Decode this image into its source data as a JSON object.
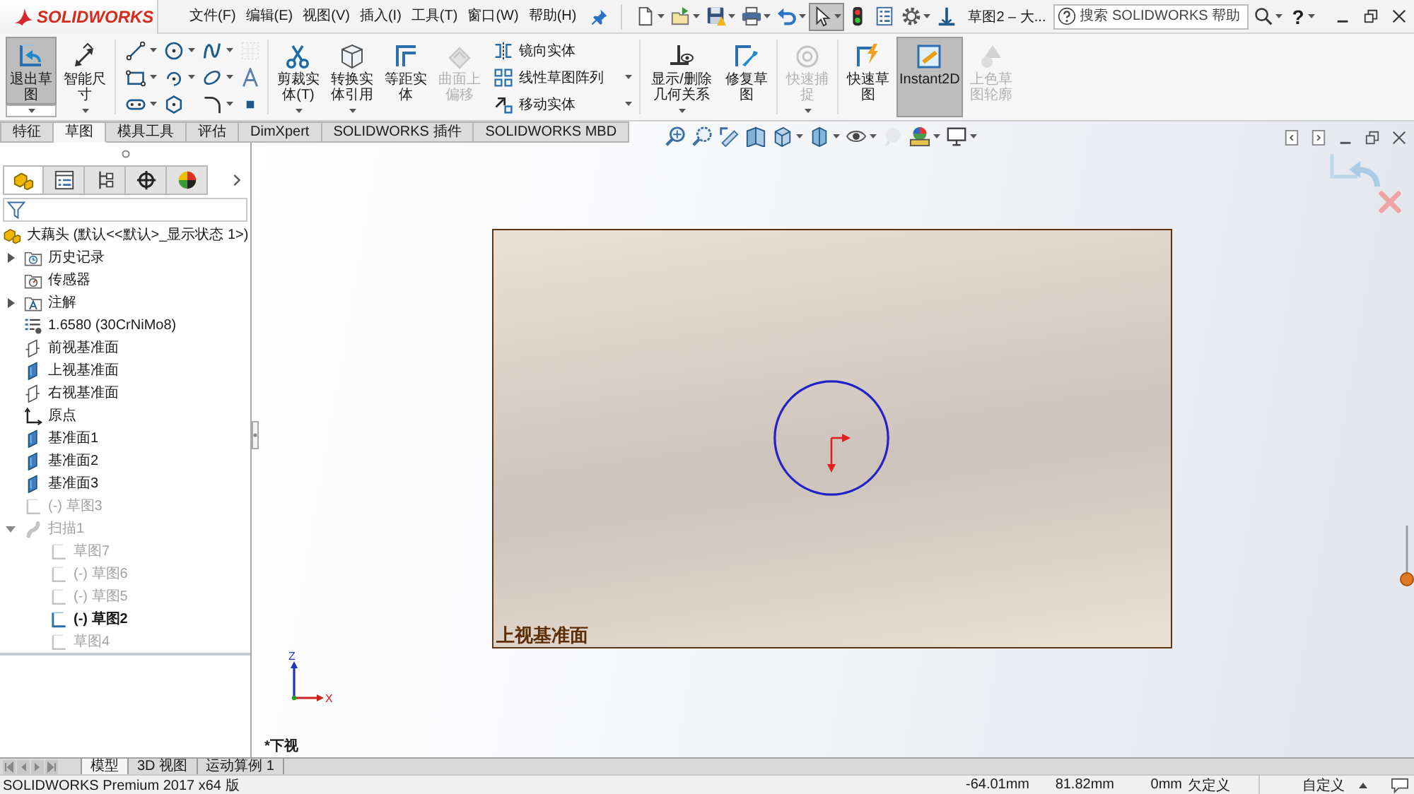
{
  "title_bar": {
    "logo": "SOLIDWORKS",
    "menu": [
      "文件(F)",
      "编辑(E)",
      "视图(V)",
      "插入(I)",
      "工具(T)",
      "窗口(W)",
      "帮助(H)"
    ],
    "quick_tools": [
      {
        "kind": "new",
        "dropdown": true,
        "selected": false
      },
      {
        "kind": "open",
        "dropdown": true,
        "selected": false
      },
      {
        "kind": "save",
        "dropdown": true,
        "selected": false
      },
      {
        "kind": "print",
        "dropdown": true,
        "selected": false
      },
      {
        "kind": "undo",
        "dropdown": true,
        "selected": false
      },
      {
        "kind": "select",
        "dropdown": true,
        "selected": true
      },
      {
        "kind": "rebuild",
        "dropdown": false,
        "selected": false
      },
      {
        "kind": "properties",
        "dropdown": false,
        "selected": false
      },
      {
        "kind": "options",
        "dropdown": true,
        "selected": false
      },
      {
        "kind": "perpendicular",
        "dropdown": false,
        "selected": false
      }
    ],
    "document_title": "草图2 – 大...",
    "search": {
      "placeholder": "搜索 SOLIDWORKS 帮助"
    },
    "help": "?"
  },
  "ribbon": {
    "groups": [
      {
        "buttons": [
          {
            "kind": "exit",
            "label": "退出草图",
            "selected": true,
            "disabled": false,
            "dropdown": true
          },
          {
            "kind": "dimension",
            "label": "智能尺寸",
            "selected": false,
            "disabled": false,
            "dropdown": true
          }
        ]
      },
      {
        "tools": [
          {
            "kind": "line",
            "dropdown": true,
            "disabled": false
          },
          {
            "kind": "circle",
            "dropdown": true,
            "disabled": false
          },
          {
            "kind": "spline",
            "dropdown": true,
            "disabled": false
          },
          {
            "kind": "grid",
            "dropdown": false,
            "disabled": true
          },
          {
            "kind": "rectangle",
            "dropdown": true,
            "disabled": false
          },
          {
            "kind": "arc",
            "dropdown": true,
            "disabled": false
          },
          {
            "kind": "ellipse",
            "dropdown": true,
            "disabled": false
          },
          {
            "kind": "text",
            "dropdown": false,
            "disabled": false
          },
          {
            "kind": "slot",
            "dropdown": true,
            "disabled": false
          },
          {
            "kind": "polygon",
            "dropdown": false,
            "disabled": false
          },
          {
            "kind": "fillet",
            "dropdown": true,
            "disabled": false
          },
          {
            "kind": "point",
            "dropdown": false,
            "disabled": false
          }
        ]
      },
      {
        "buttons": [
          {
            "kind": "trim",
            "label": "剪裁实体(T)",
            "selected": false,
            "disabled": false,
            "dropdown": true
          },
          {
            "kind": "convert",
            "label": "转换实体引用",
            "selected": false,
            "disabled": false,
            "dropdown": true
          },
          {
            "kind": "offset",
            "label": "等距实体",
            "selected": false,
            "disabled": false,
            "dropdown": false
          },
          {
            "kind": "surfaceoffset",
            "label": "曲面上偏移",
            "selected": false,
            "disabled": true,
            "dropdown": false
          }
        ],
        "rows": [
          {
            "kind": "mirror",
            "label": "镜向实体",
            "dropdown": false
          },
          {
            "kind": "pattern",
            "label": "线性草图阵列",
            "dropdown": true
          },
          {
            "kind": "move",
            "label": "移动实体",
            "dropdown": true
          }
        ]
      },
      {
        "buttons": [
          {
            "kind": "relations",
            "label": "显示/删除几何关系",
            "selected": false,
            "disabled": false,
            "dropdown": true
          },
          {
            "kind": "repair",
            "label": "修复草图",
            "selected": false,
            "disabled": false,
            "dropdown": false
          }
        ]
      },
      {
        "buttons": [
          {
            "kind": "snap",
            "label": "快速捕捉",
            "selected": false,
            "disabled": true,
            "dropdown": true
          }
        ]
      },
      {
        "buttons": [
          {
            "kind": "rapid",
            "label": "快速草图",
            "selected": false,
            "disabled": false,
            "dropdown": false
          },
          {
            "kind": "instant2d",
            "label": "Instant2D",
            "selected": true,
            "disabled": false,
            "dropdown": false
          },
          {
            "kind": "shaded",
            "label": "上色草图轮廓",
            "selected": false,
            "disabled": true,
            "dropdown": false
          }
        ]
      }
    ]
  },
  "command_tabs": [
    {
      "label": "特征",
      "selected": false
    },
    {
      "label": "草图",
      "selected": true
    },
    {
      "label": "模具工具",
      "selected": false
    },
    {
      "label": "评估",
      "selected": false
    },
    {
      "label": "DimXpert",
      "selected": false
    },
    {
      "label": "SOLIDWORKS 插件",
      "selected": false
    },
    {
      "label": "SOLIDWORKS MBD",
      "selected": false
    }
  ],
  "feature_panel": {
    "tabs": [
      {
        "kind": "feature",
        "selected": true
      },
      {
        "kind": "property",
        "selected": false
      },
      {
        "kind": "configuration",
        "selected": false
      },
      {
        "kind": "dimxpert",
        "selected": false
      },
      {
        "kind": "display",
        "selected": false
      }
    ],
    "tree": {
      "kind": "part",
      "label": "大藕头 (默认<<默认>_显示状态 1>)",
      "dimmed": false,
      "active": false,
      "children": [
        {
          "kind": "history",
          "label": "历史记录",
          "dimmed": false,
          "active": false,
          "expanded": false
        },
        {
          "kind": "sensor",
          "label": "传感器",
          "dimmed": false,
          "active": false
        },
        {
          "kind": "annotation",
          "label": "注解",
          "dimmed": false,
          "active": false,
          "expanded": false
        },
        {
          "kind": "material",
          "label": "1.6580 (30CrNiMo8)",
          "dimmed": false,
          "active": false
        },
        {
          "kind": "plane",
          "label": "前视基准面",
          "dimmed": false,
          "active": false,
          "shown": false
        },
        {
          "kind": "plane",
          "label": "上视基准面",
          "dimmed": false,
          "active": false,
          "shown": true
        },
        {
          "kind": "plane",
          "label": "右视基准面",
          "dimmed": false,
          "active": false,
          "shown": false
        },
        {
          "kind": "origin",
          "label": "原点",
          "dimmed": false,
          "active": false
        },
        {
          "kind": "plane",
          "label": "基准面1",
          "dimmed": false,
          "active": false,
          "shown": true
        },
        {
          "kind": "plane",
          "label": "基准面2",
          "dimmed": false,
          "active": false,
          "shown": true
        },
        {
          "kind": "plane",
          "label": "基准面3",
          "dimmed": false,
          "active": false,
          "shown": true
        },
        {
          "kind": "sketch",
          "label": "(-) 草图3",
          "dimmed": true,
          "active": false
        },
        {
          "kind": "sweep",
          "label": "扫描1",
          "dimmed": true,
          "active": false,
          "expanded": true,
          "children": [
            {
              "kind": "sketch",
              "label": "草图7",
              "dimmed": true,
              "active": false
            },
            {
              "kind": "sketch",
              "label": "(-) 草图6",
              "dimmed": true,
              "active": false
            },
            {
              "kind": "sketch",
              "label": "(-) 草图5",
              "dimmed": true,
              "active": false
            },
            {
              "kind": "sketch",
              "label": "(-) 草图2",
              "dimmed": false,
              "active": true
            },
            {
              "kind": "sketch",
              "label": "草图4",
              "dimmed": true,
              "active": false
            }
          ]
        }
      ]
    }
  },
  "graphics_area": {
    "view_tools": [
      {
        "kind": "zoomfit",
        "dropdown": false,
        "disabled": false
      },
      {
        "kind": "zoomarea",
        "dropdown": false,
        "disabled": false
      },
      {
        "kind": "previous",
        "dropdown": false,
        "disabled": false
      },
      {
        "kind": "section",
        "dropdown": false,
        "disabled": false
      },
      {
        "kind": "orientation",
        "dropdown": true,
        "disabled": false
      },
      {
        "kind": "display",
        "dropdown": true,
        "disabled": false
      },
      {
        "kind": "hide",
        "dropdown": true,
        "disabled": false
      },
      {
        "kind": "appearance",
        "dropdown": false,
        "disabled": true
      },
      {
        "kind": "scene",
        "dropdown": true,
        "disabled": false
      },
      {
        "kind": "settings",
        "dropdown": true,
        "disabled": false
      }
    ],
    "plane": {
      "label": "上视基准面"
    },
    "axes": {
      "z": "Z",
      "x": "X"
    },
    "view_name": "*下视"
  },
  "bottom_tabs": [
    {
      "label": "模型",
      "selected": true
    },
    {
      "label": "3D 视图",
      "selected": false
    },
    {
      "label": "运动算例 1",
      "selected": false
    }
  ],
  "status_bar": {
    "product": "SOLIDWORKS Premium 2017 x64 版",
    "x": "-64.01mm",
    "y": "81.82mm",
    "z": "0mm",
    "sketch_state": "欠定义",
    "units": "自定义"
  }
}
